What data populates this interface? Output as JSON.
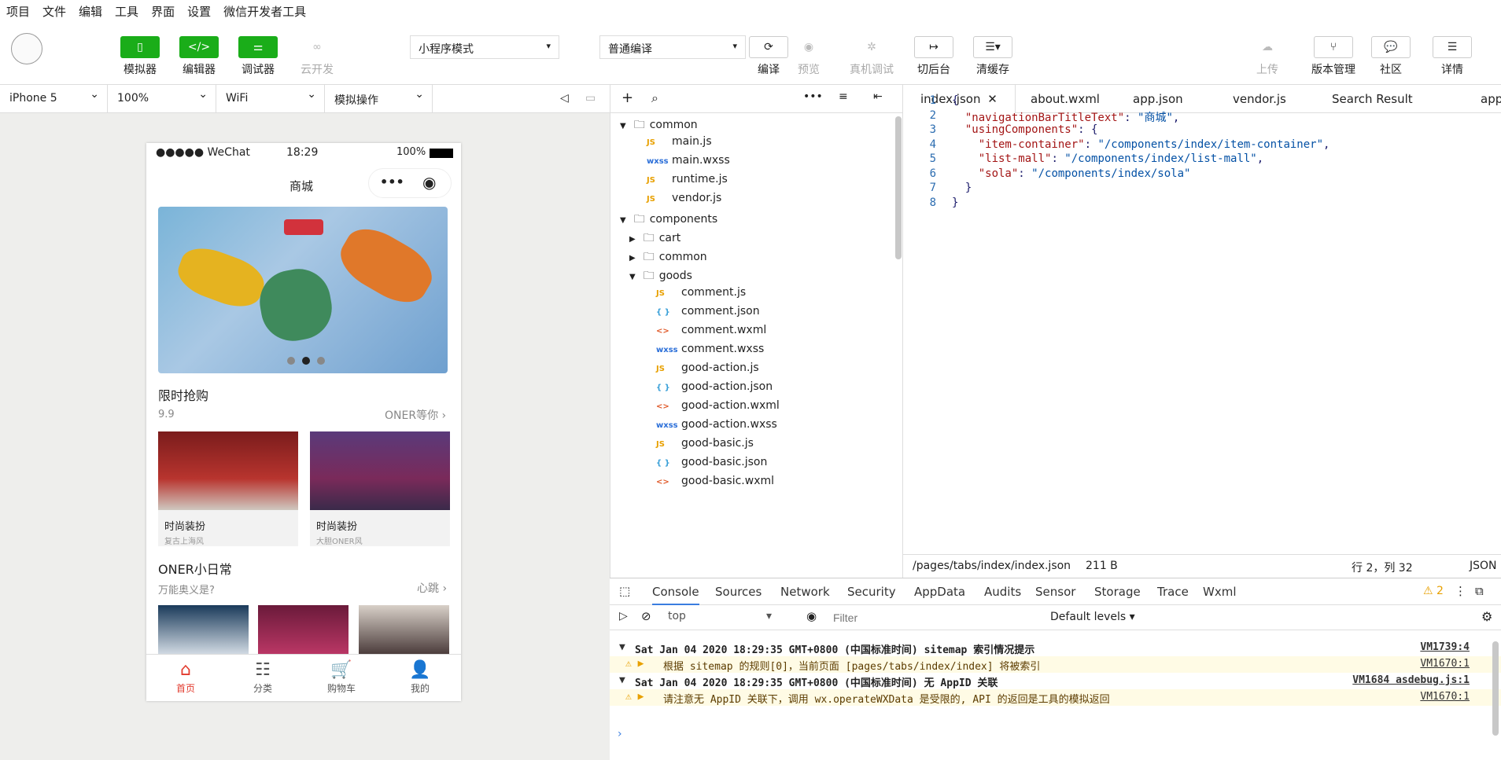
{
  "menu": [
    "项目",
    "文件",
    "编辑",
    "工具",
    "界面",
    "设置",
    "微信开发者工具"
  ],
  "toolbar": {
    "simulator": "模拟器",
    "editor": "编辑器",
    "debugger": "调试器",
    "cloud": "云开发",
    "mode": "小程序模式",
    "compile_mode": "普通编译",
    "compile": "编译",
    "preview": "预览",
    "real_debug": "真机调试",
    "background": "切后台",
    "clear_cache": "清缓存",
    "upload": "上传",
    "version": "版本管理",
    "community": "社区",
    "details": "详情"
  },
  "simbar": {
    "device": "iPhone 5",
    "zoom": "100%",
    "network": "WiFi",
    "ops": "模拟操作"
  },
  "phone": {
    "carrier": "●●●●● WeChat",
    "time": "18:29",
    "battery": "100%",
    "title": "商城",
    "sec1_title": "限时抢购",
    "sec1_sub": "9.9",
    "sec1_more": "ONER等你",
    "card1_title": "时尚装扮",
    "card1_sub": "复古上海风",
    "card2_title": "时尚装扮",
    "card2_sub": "大胆ONER风",
    "sec2_title": "ONER小日常",
    "sec2_sub": "万能奥义是?",
    "sec2_more": "心跳",
    "tabs": [
      "首页",
      "分类",
      "购物车",
      "我的"
    ]
  },
  "tree": [
    {
      "label": "common",
      "kind": "folder",
      "open": true,
      "indent": 0
    },
    {
      "label": "main.js",
      "kind": "JS",
      "indent": 1
    },
    {
      "label": "main.wxss",
      "kind": "WXSS",
      "indent": 1
    },
    {
      "label": "runtime.js",
      "kind": "JS",
      "indent": 1
    },
    {
      "label": "vendor.js",
      "kind": "JS",
      "indent": 1
    },
    {
      "label": "components",
      "kind": "folder",
      "open": true,
      "indent": 0
    },
    {
      "label": "cart",
      "kind": "folder",
      "open": false,
      "indent": 1
    },
    {
      "label": "common",
      "kind": "folder",
      "open": false,
      "indent": 1
    },
    {
      "label": "goods",
      "kind": "folder",
      "open": true,
      "indent": 1
    },
    {
      "label": "comment.js",
      "kind": "JS",
      "indent": 2
    },
    {
      "label": "comment.json",
      "kind": "JSON",
      "indent": 2
    },
    {
      "label": "comment.wxml",
      "kind": "WXML",
      "indent": 2
    },
    {
      "label": "comment.wxss",
      "kind": "WXSS",
      "indent": 2
    },
    {
      "label": "good-action.js",
      "kind": "JS",
      "indent": 2
    },
    {
      "label": "good-action.json",
      "kind": "JSON",
      "indent": 2
    },
    {
      "label": "good-action.wxml",
      "kind": "WXML",
      "indent": 2
    },
    {
      "label": "good-action.wxss",
      "kind": "WXSS",
      "indent": 2
    },
    {
      "label": "good-basic.js",
      "kind": "JS",
      "indent": 2
    },
    {
      "label": "good-basic.json",
      "kind": "JSON",
      "indent": 2
    },
    {
      "label": "good-basic.wxml",
      "kind": "WXML",
      "indent": 2
    }
  ],
  "editor_tabs": [
    "index.json",
    "about.wxml",
    "app.json",
    "vendor.js",
    "Search Result",
    "app"
  ],
  "code": [
    "{",
    "  \"navigationBarTitleText\": \"商城\",",
    "  \"usingComponents\": {",
    "    \"item-container\": \"/components/index/item-container\",",
    "    \"list-mall\": \"/components/index/list-mall\",",
    "    \"sola\": \"/components/index/sola\"",
    "  }",
    "}"
  ],
  "status": {
    "path": "/pages/tabs/index/index.json",
    "size": "211 B",
    "pos": "行 2，列 32",
    "lang": "JSON"
  },
  "devtools": {
    "tabs": [
      "Console",
      "Sources",
      "Network",
      "Security",
      "AppData",
      "Audits",
      "Sensor",
      "Storage",
      "Trace",
      "Wxml"
    ],
    "warn_count": "2",
    "context": "top",
    "filter_placeholder": "Filter",
    "levels": "Default levels",
    "logs": [
      {
        "text": "Sat Jan 04 2020 18:29:35 GMT+0800 (中国标准时间) sitemap 索引情况提示",
        "link": "VM1739:4",
        "warn": false
      },
      {
        "text": "根据 sitemap 的规则[0]，当前页面 [pages/tabs/index/index] 将被索引",
        "link": "VM1670:1",
        "warn": true
      },
      {
        "text": "Sat Jan 04 2020 18:29:35 GMT+0800 (中国标准时间) 无 AppID 关联",
        "link": "VM1684 asdebug.js:1",
        "warn": false
      },
      {
        "text": "请注意无 AppID 关联下，调用 wx.operateWXData 是受限的, API 的返回是工具的模拟返回",
        "link": "VM1670:1",
        "warn": true
      }
    ]
  }
}
